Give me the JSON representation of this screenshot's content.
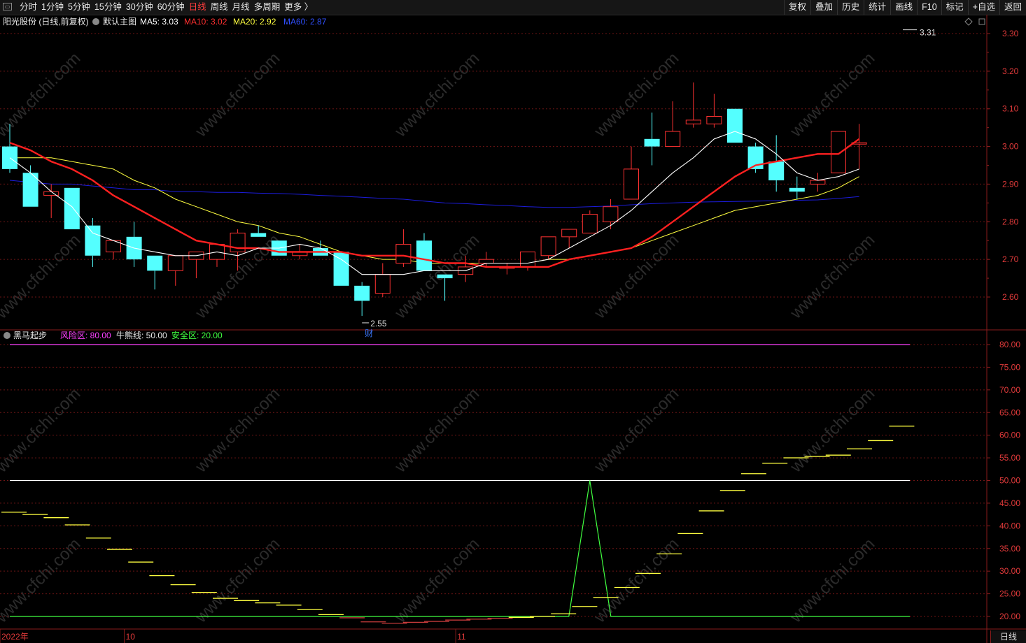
{
  "toolbar": {
    "tabs": [
      {
        "label": "分时"
      },
      {
        "label": "1分钟"
      },
      {
        "label": "5分钟"
      },
      {
        "label": "15分钟"
      },
      {
        "label": "30分钟"
      },
      {
        "label": "60分钟"
      },
      {
        "label": "日线",
        "active": true
      },
      {
        "label": "周线"
      },
      {
        "label": "月线"
      },
      {
        "label": "多周期"
      },
      {
        "label": "更多 〉"
      }
    ],
    "tools": [
      {
        "label": "复权"
      },
      {
        "label": "叠加"
      },
      {
        "label": "历史"
      },
      {
        "label": "统计"
      },
      {
        "label": "画线"
      },
      {
        "label": "F10"
      },
      {
        "label": "标记"
      },
      {
        "label": "+自选"
      },
      {
        "label": "返回"
      }
    ]
  },
  "main_header": {
    "stock": "阳光股份 (日线,前复权)",
    "template": "默认主图",
    "ma5_label": "MA5: 3.03",
    "ma10_label": "MA10: 3.02",
    "ma20_label": "MA20: 2.92",
    "ma60_label": "MA60: 2.87"
  },
  "indicator_header": {
    "name": "黑马起步",
    "risk_label": "风险区: 80.00",
    "bull_label": "牛熊线: 50.00",
    "safe_label": "安全区: 20.00"
  },
  "annotations": {
    "high_label": "3.31",
    "low_label": "2.55",
    "fin_marker": "财"
  },
  "xaxis": {
    "labels": [
      {
        "text": "2022年",
        "index": 0
      },
      {
        "text": "10",
        "index": 6
      },
      {
        "text": "11",
        "index": 22
      }
    ],
    "period_label": "日线"
  },
  "watermark": "www.cfchi.com",
  "colors": {
    "up": "#ff3232",
    "down": "#54ffff",
    "ma5": "#ffffff",
    "ma10": "#ff2020",
    "ma20": "#ffff40",
    "ma60": "#1c1cdc",
    "risk": "#ff40ff",
    "bull": "#ffffff",
    "safe": "#40ff40",
    "axis": "#8a1c1c",
    "grid": "#6e1515"
  },
  "chart_data": {
    "type": "candlestick",
    "price_axis": [
      3.3,
      3.2,
      3.1,
      3.0,
      2.9,
      2.8,
      2.7,
      2.6
    ],
    "price_range": [
      2.535,
      3.335
    ],
    "indicator_axis": [
      80,
      75,
      70,
      65,
      60,
      55,
      50,
      45,
      40,
      35,
      30,
      25,
      20
    ],
    "indicator_range": [
      18.0,
      82.0
    ],
    "candles": [
      [
        3.0,
        2.94,
        3.06,
        2.93
      ],
      [
        2.93,
        2.84,
        2.95,
        2.84
      ],
      [
        2.87,
        2.88,
        2.9,
        2.81
      ],
      [
        2.89,
        2.78,
        2.89,
        2.78
      ],
      [
        2.79,
        2.71,
        2.81,
        2.68
      ],
      [
        2.72,
        2.75,
        2.75,
        2.7
      ],
      [
        2.76,
        2.7,
        2.8,
        2.68
      ],
      [
        2.71,
        2.67,
        2.71,
        2.62
      ],
      [
        2.67,
        2.71,
        2.71,
        2.63
      ],
      [
        2.7,
        2.72,
        2.72,
        2.65
      ],
      [
        2.7,
        2.74,
        2.74,
        2.68
      ],
      [
        2.72,
        2.77,
        2.78,
        2.67
      ],
      [
        2.77,
        2.76,
        2.79,
        2.76
      ],
      [
        2.75,
        2.71,
        2.75,
        2.71
      ],
      [
        2.71,
        2.72,
        2.74,
        2.7
      ],
      [
        2.73,
        2.71,
        2.75,
        2.71
      ],
      [
        2.72,
        2.63,
        2.72,
        2.63
      ],
      [
        2.63,
        2.59,
        2.64,
        2.55
      ],
      [
        2.61,
        2.66,
        2.69,
        2.6
      ],
      [
        2.69,
        2.74,
        2.78,
        2.68
      ],
      [
        2.75,
        2.67,
        2.77,
        2.67
      ],
      [
        2.66,
        2.65,
        2.66,
        2.59
      ],
      [
        2.66,
        2.68,
        2.71,
        2.64
      ],
      [
        2.69,
        2.7,
        2.72,
        2.68
      ],
      [
        2.68,
        2.68,
        2.69,
        2.66
      ],
      [
        2.68,
        2.72,
        2.72,
        2.67
      ],
      [
        2.71,
        2.76,
        2.76,
        2.7
      ],
      [
        2.76,
        2.78,
        2.78,
        2.73
      ],
      [
        2.77,
        2.82,
        2.83,
        2.77
      ],
      [
        2.8,
        2.84,
        2.86,
        2.78
      ],
      [
        2.86,
        2.94,
        3.0,
        2.86
      ],
      [
        3.02,
        3.0,
        3.09,
        2.95
      ],
      [
        3.0,
        3.04,
        3.12,
        3.0
      ],
      [
        3.06,
        3.07,
        3.17,
        3.05
      ],
      [
        3.06,
        3.08,
        3.14,
        3.05
      ],
      [
        3.1,
        3.01,
        3.1,
        3.01
      ],
      [
        3.0,
        2.94,
        3.01,
        2.93
      ],
      [
        2.96,
        2.91,
        3.03,
        2.88
      ],
      [
        2.89,
        2.88,
        2.92,
        2.86
      ],
      [
        2.9,
        2.91,
        2.93,
        2.88
      ],
      [
        2.93,
        3.04,
        3.04,
        2.93
      ],
      [
        3.01,
        3.01,
        3.06,
        2.94
      ]
    ],
    "ma5": [
      2.97,
      2.93,
      2.88,
      2.84,
      2.77,
      2.75,
      2.73,
      2.72,
      2.71,
      2.71,
      2.72,
      2.71,
      2.73,
      2.73,
      2.74,
      2.73,
      2.7,
      2.66,
      2.66,
      2.66,
      2.67,
      2.67,
      2.67,
      2.69,
      2.69,
      2.69,
      2.7,
      2.73,
      2.76,
      2.79,
      2.83,
      2.88,
      2.93,
      2.97,
      3.02,
      3.04,
      3.02,
      2.98,
      2.93,
      2.91,
      2.92,
      2.94
    ],
    "ma10": [
      3.01,
      2.99,
      2.96,
      2.94,
      2.91,
      2.87,
      2.84,
      2.81,
      2.78,
      2.75,
      2.74,
      2.73,
      2.73,
      2.72,
      2.72,
      2.72,
      2.72,
      2.71,
      2.71,
      2.71,
      2.7,
      2.69,
      2.69,
      2.68,
      2.68,
      2.68,
      2.68,
      2.7,
      2.71,
      2.72,
      2.73,
      2.76,
      2.8,
      2.84,
      2.88,
      2.92,
      2.95,
      2.96,
      2.97,
      2.98,
      2.98,
      3.02
    ],
    "ma20": [
      2.97,
      2.97,
      2.97,
      2.96,
      2.95,
      2.94,
      2.91,
      2.89,
      2.86,
      2.84,
      2.82,
      2.8,
      2.79,
      2.77,
      2.76,
      2.74,
      2.72,
      2.71,
      2.7,
      2.7,
      2.69,
      2.69,
      2.69,
      2.69,
      2.69,
      2.69,
      2.7,
      2.7,
      2.71,
      2.72,
      2.73,
      2.75,
      2.77,
      2.79,
      2.81,
      2.83,
      2.84,
      2.85,
      2.86,
      2.87,
      2.89,
      2.92
    ],
    "ma60": [
      2.91,
      2.905,
      2.9,
      2.9,
      2.895,
      2.89,
      2.885,
      2.885,
      2.88,
      2.88,
      2.878,
      2.878,
      2.876,
      2.875,
      2.873,
      2.87,
      2.868,
      2.865,
      2.862,
      2.86,
      2.855,
      2.85,
      2.848,
      2.845,
      2.843,
      2.84,
      2.838,
      2.838,
      2.84,
      2.842,
      2.845,
      2.848,
      2.85,
      2.852,
      2.853,
      2.854,
      2.855,
      2.856,
      2.857,
      2.858,
      2.862,
      2.867
    ],
    "indicator_yellow": [
      43.0,
      42.5,
      41.8,
      40.2,
      37.3,
      34.8,
      32.0,
      29.0,
      27.0,
      25.3,
      24.0,
      23.5,
      23.0,
      22.5,
      21.5,
      20.4,
      19.7,
      18.8,
      18.5,
      18.7,
      18.9,
      19.2,
      19.4,
      19.6,
      19.8,
      20.0,
      20.6,
      22.2,
      24.2,
      26.4,
      29.5,
      33.8,
      38.3,
      43.3,
      47.8,
      51.5,
      53.8,
      55.0,
      55.3,
      55.6,
      57.0,
      58.8,
      62.0
    ],
    "indicator_green_peak": {
      "index": 28,
      "value": 50
    }
  }
}
